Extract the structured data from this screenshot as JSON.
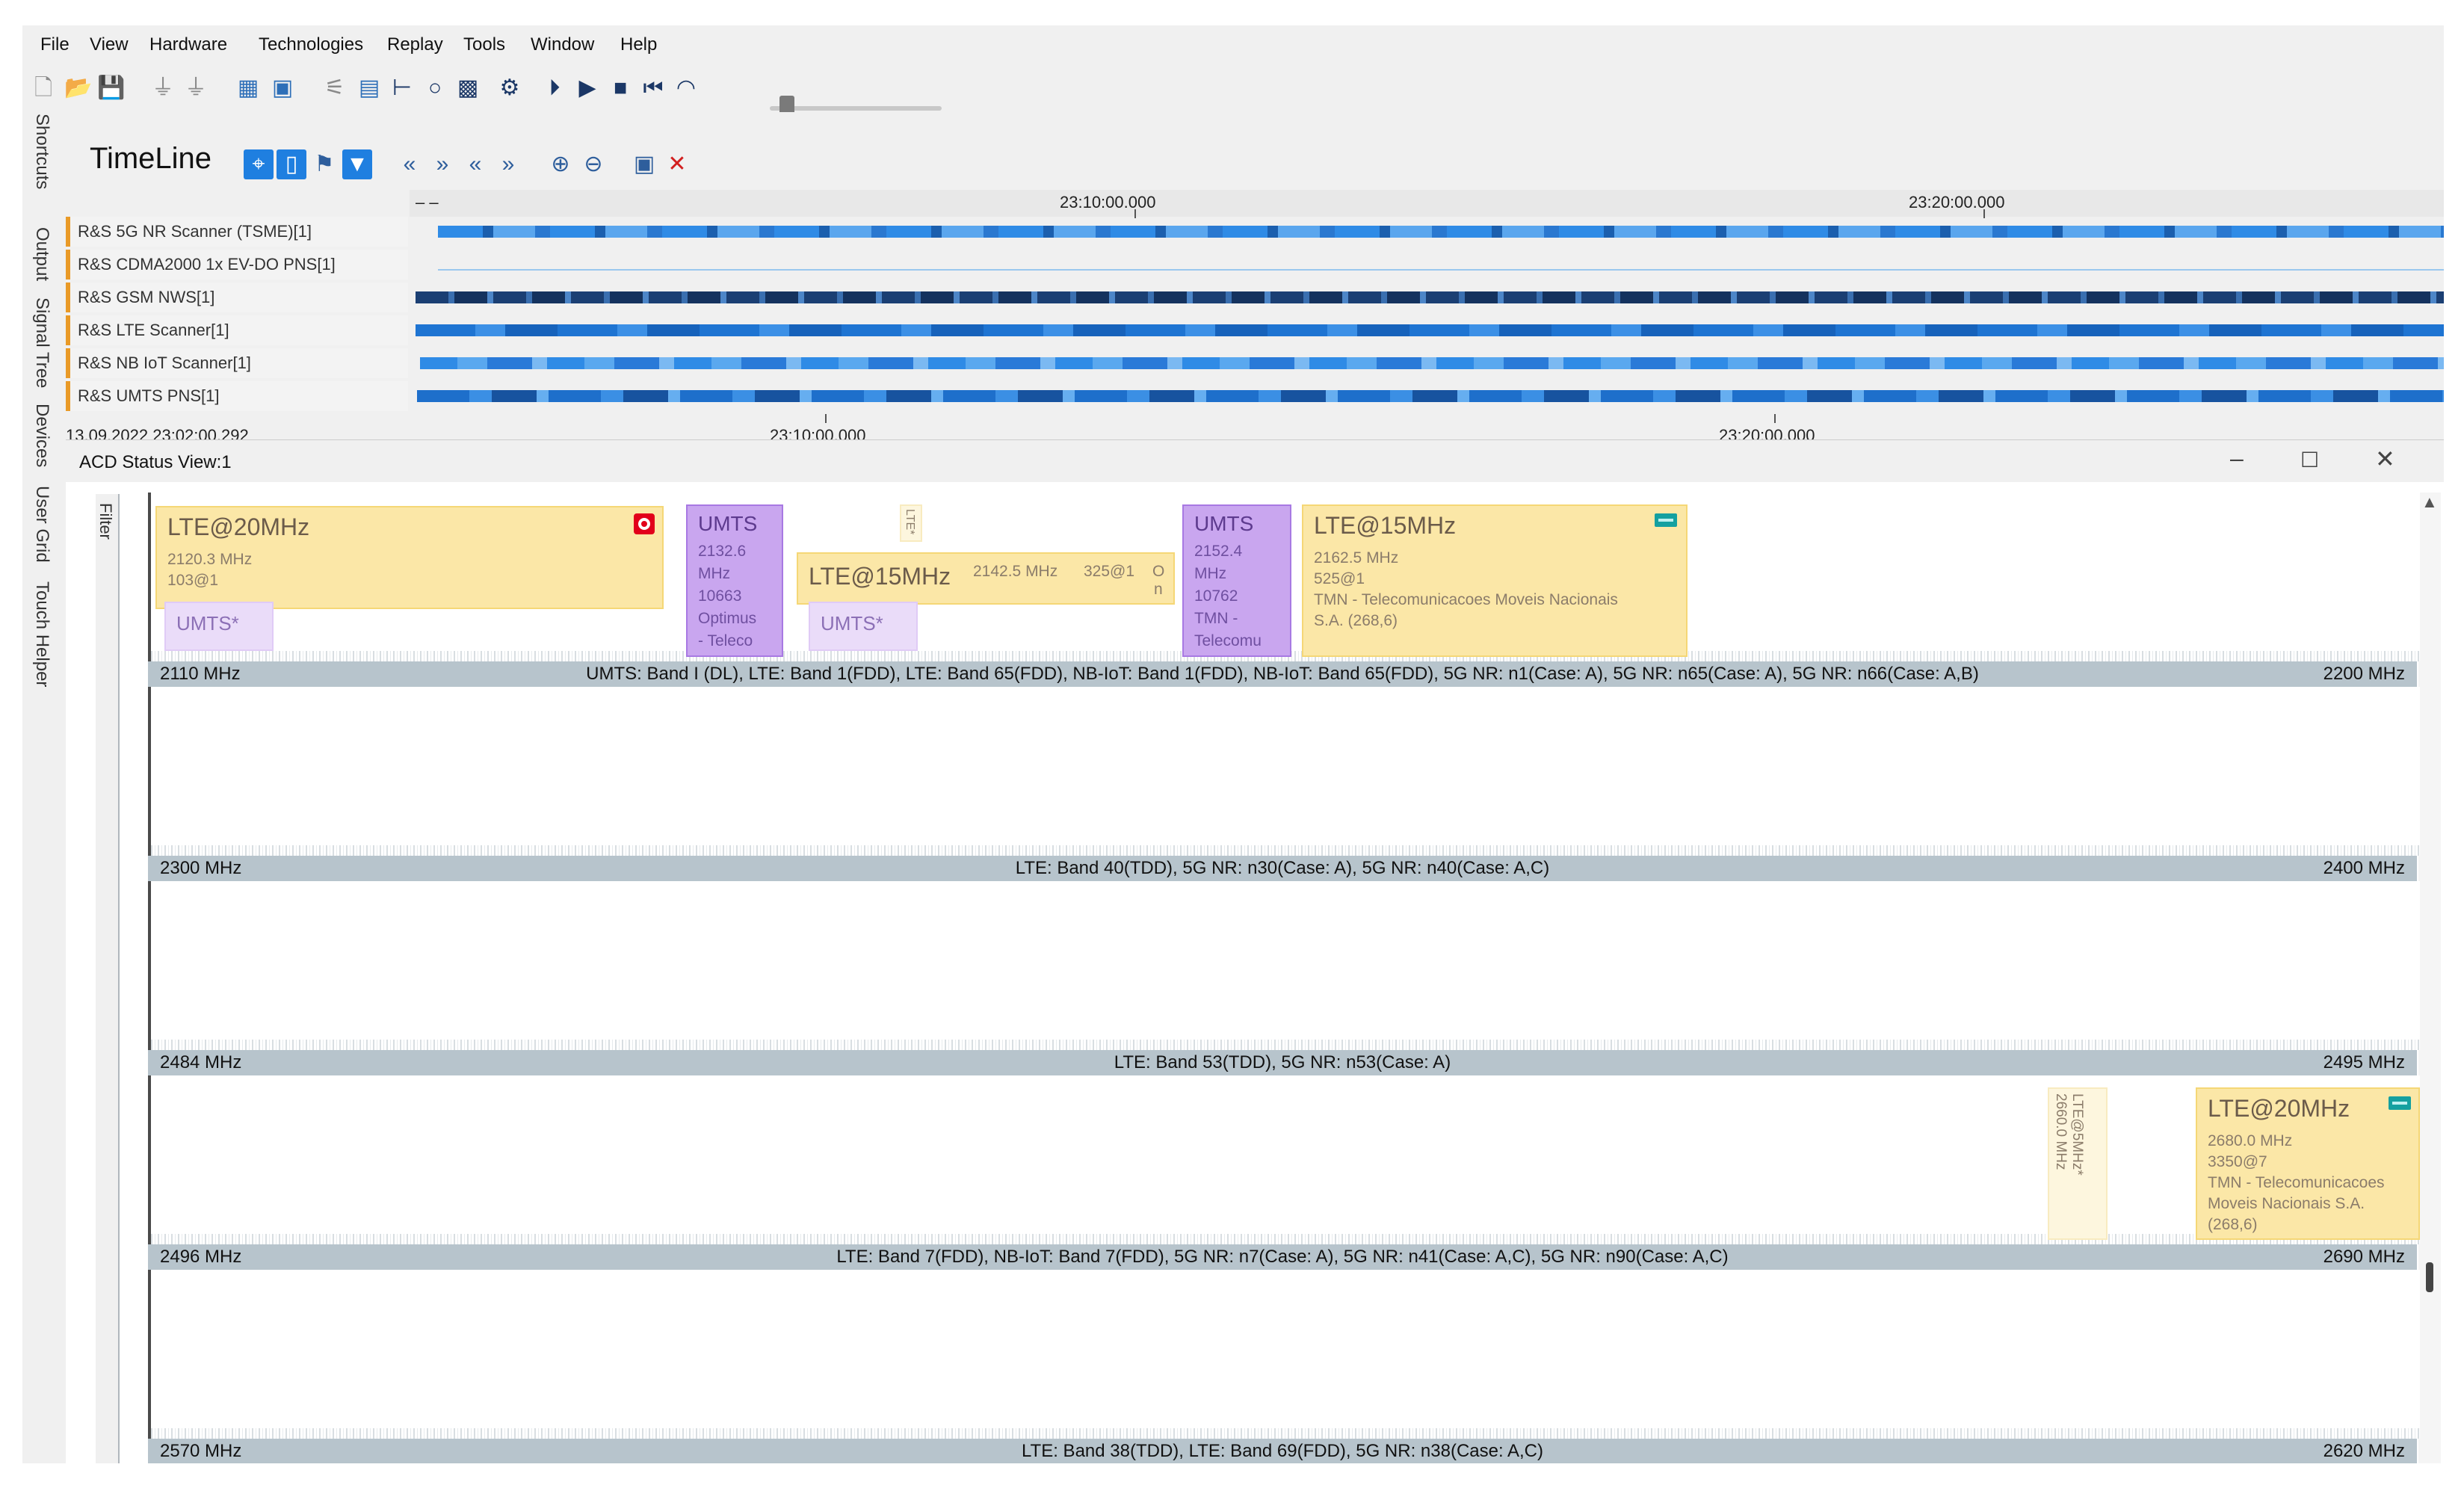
{
  "menu": {
    "items": [
      "File",
      "View",
      "Hardware",
      "Technologies",
      "Replay",
      "Tools",
      "Window",
      "Help"
    ]
  },
  "toolbar": {
    "icons": [
      "new-file-icon",
      "open-folder-icon",
      "save-icon",
      "device-connect-icon",
      "device-disconnect-icon",
      "layout-icon",
      "workspace-icon",
      "settings-icon",
      "play-step-icon",
      "play-icon",
      "stop-icon",
      "rewind-icon",
      "speed-icon"
    ],
    "replay_position": 0.1
  },
  "side_tabs": [
    "Shortcuts",
    "Output",
    "Signal Tree",
    "Devices",
    "User Grid",
    "Touch Helper"
  ],
  "timeline": {
    "title": "TimeLine",
    "ruler_top": {
      "left": "– –",
      "marks": [
        "23:10:00.000",
        "23:20:00.000"
      ]
    },
    "tracks": [
      "R&S 5G NR Scanner (TSME)[1]",
      "R&S CDMA2000 1x EV-DO PNS[1]",
      "R&S GSM NWS[1]",
      "R&S LTE Scanner[1]",
      "R&S NB IoT Scanner[1]",
      "R&S UMTS PNS[1]"
    ],
    "ruler_bottom": {
      "start": "13.09.2022 23:02:00.292",
      "marks": [
        "23:10:00.000",
        "23:20:00.000"
      ]
    }
  },
  "acd": {
    "title": "ACD Status View:1",
    "filter_label": "Filter",
    "window_controls": {
      "minimize": "–",
      "maximize": "☐",
      "close": "✕"
    },
    "bands": [
      {
        "start": "2110 MHz",
        "label": "UMTS: Band I (DL), LTE: Band 1(FDD), LTE: Band 65(FDD), NB-IoT: Band 1(FDD), NB-IoT: Band 65(FDD), 5G NR: n1(Case: A), 5G NR: n65(Case: A), 5G NR: n66(Case: A,B)",
        "end": "2200 MHz"
      },
      {
        "start": "2300 MHz",
        "label": "LTE: Band 40(TDD), 5G NR: n30(Case: A), 5G NR: n40(Case: A,C)",
        "end": "2400 MHz"
      },
      {
        "start": "2484 MHz",
        "label": "LTE: Band 53(TDD), 5G NR: n53(Case: A)",
        "end": "2495 MHz"
      },
      {
        "start": "2496 MHz",
        "label": "LTE: Band 7(FDD), NB-IoT: Band 7(FDD), 5G NR: n7(Case: A), 5G NR: n41(Case: A,C), 5G NR: n90(Case: A,C)",
        "end": "2690 MHz"
      },
      {
        "start": "2570 MHz",
        "label": "LTE: Band 38(TDD), LTE: Band 69(FDD), 5G NR: n38(Case: A,C)",
        "end": "2620 MHz"
      }
    ],
    "cards": {
      "lte1": {
        "title": "LTE@20MHz",
        "freq": "2120.3 MHz",
        "cell": "103@1"
      },
      "umts_faint1": {
        "title": "UMTS*"
      },
      "umts1": {
        "title": "UMTS",
        "l1": "2132.6",
        "l2": "MHz",
        "l3": "10663",
        "l4": "Optimus",
        "l5": "- Teleco"
      },
      "lte_small": {
        "title": "LTE*"
      },
      "lte2": {
        "title": "LTE@15MHz",
        "freq": "2142.5 MHz",
        "cell": "325@1",
        "extra": "O",
        "extra2": "n"
      },
      "umts_faint2": {
        "title": "UMTS*"
      },
      "umts2": {
        "title": "UMTS",
        "l1": "2152.4",
        "l2": "MHz",
        "l3": "10762",
        "l4": "TMN -",
        "l5": "Telecomu"
      },
      "lte3": {
        "title": "LTE@15MHz",
        "freq": "2162.5 MHz",
        "cell": "525@1",
        "op1": "TMN - Telecomunicacoes Moveis Nacionais",
        "op2": "S.A. (268,6)"
      },
      "lte_v": {
        "title": "LTE@5MHz*",
        "freq": "2660.0 MHz"
      },
      "lte4": {
        "title": "LTE@20MHz",
        "freq": "2680.0 MHz",
        "cell": "3350@7",
        "op1": "TMN - Telecomunicacoes",
        "op2": "Moveis Nacionais S.A.",
        "op3": "(268,6)"
      }
    }
  },
  "colors": {
    "accent": "#1f7fe0",
    "lte_card": "#fbe7a7",
    "umts_card": "#c9a6ef",
    "band_bar": "#b7c4cc",
    "track_dark": "#1b3f73",
    "track_light": "#2f8be6",
    "operator_red": "#e2001a",
    "operator_teal": "#14a0a0"
  }
}
